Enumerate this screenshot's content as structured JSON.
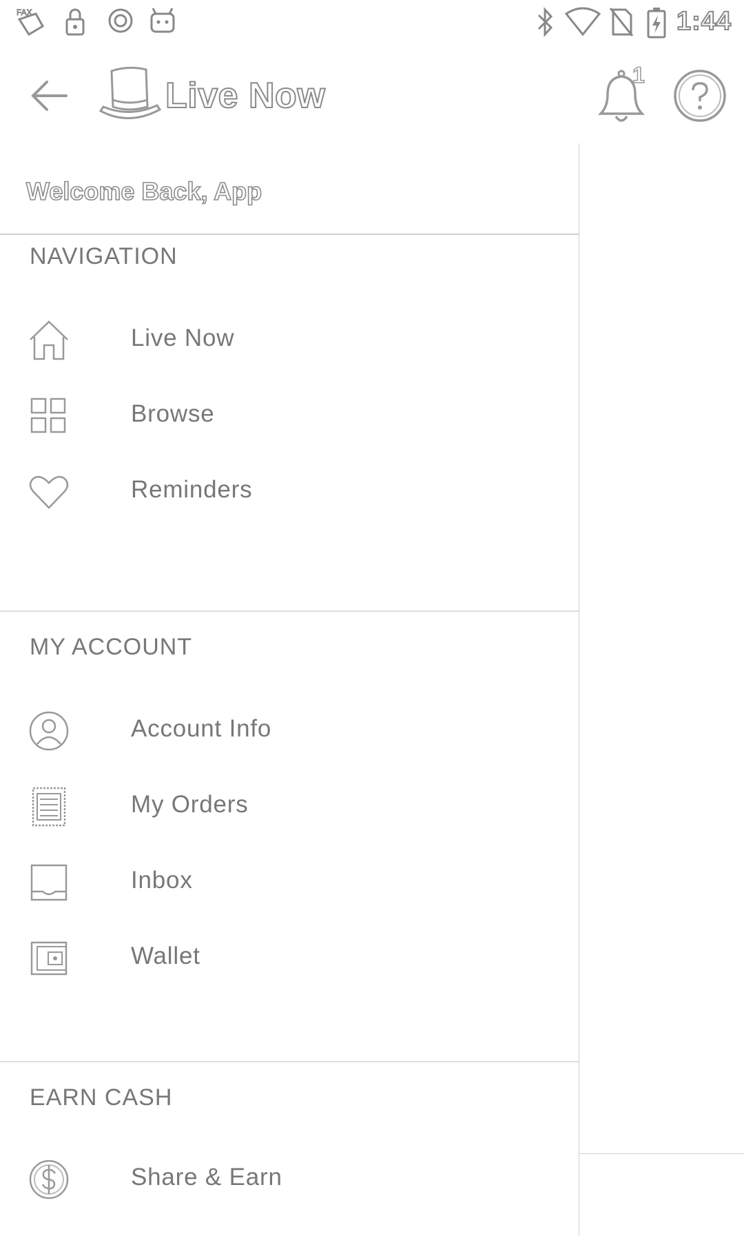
{
  "status_bar": {
    "time": "1:44",
    "icons": [
      "fax-icon",
      "lock-icon",
      "circle-status-icon",
      "android-icon",
      "bluetooth-icon",
      "wifi-icon",
      "no-sim-icon",
      "battery-charging-icon"
    ]
  },
  "app_bar": {
    "title": "Live Now",
    "notification_count": "1",
    "icons": [
      "back-arrow-icon",
      "top-hat-logo",
      "bell-icon",
      "help-icon"
    ]
  },
  "drawer": {
    "welcome": "Welcome Back, App",
    "sections": [
      {
        "header": "NAVIGATION",
        "items": [
          {
            "label": "Live Now",
            "icon": "home-icon"
          },
          {
            "label": "Browse",
            "icon": "grid-icon"
          },
          {
            "label": "Reminders",
            "icon": "heart-icon"
          }
        ]
      },
      {
        "header": "MY ACCOUNT",
        "items": [
          {
            "label": "Account Info",
            "icon": "user-circle-icon"
          },
          {
            "label": "My Orders",
            "icon": "receipt-icon"
          },
          {
            "label": "Inbox",
            "icon": "inbox-icon"
          },
          {
            "label": "Wallet",
            "icon": "wallet-icon"
          }
        ]
      },
      {
        "header": "EARN CASH",
        "items": [
          {
            "label": "Share & Earn",
            "icon": "dollar-coin-icon"
          }
        ]
      }
    ]
  },
  "colors": {
    "outline_text": "#8a8a8a",
    "label_text": "#777777",
    "divider": "#dedede",
    "background": "#ffffff"
  }
}
